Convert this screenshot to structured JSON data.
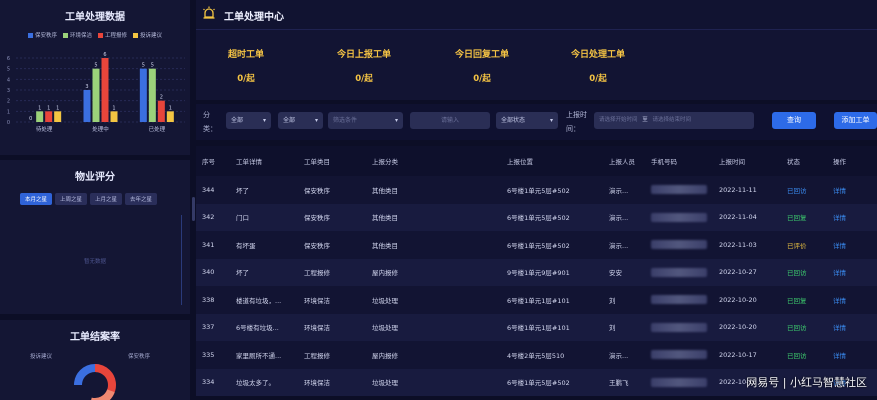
{
  "left": {
    "stats_title": "工单处理数据",
    "legend": [
      {
        "label": "保安秩序",
        "color": "#3b6fe0"
      },
      {
        "label": "环境保洁",
        "color": "#9bd27a"
      },
      {
        "label": "工程报修",
        "color": "#e8453b"
      },
      {
        "label": "投诉建议",
        "color": "#f3c542"
      }
    ],
    "y_ticks": [
      "6",
      "5",
      "4",
      "3",
      "2",
      "1",
      "0"
    ],
    "groups": [
      {
        "label": "待处理",
        "values": [
          "0",
          "1",
          "1",
          "1"
        ]
      },
      {
        "label": "处理中",
        "values": [
          "3",
          "5",
          "6",
          "1"
        ]
      },
      {
        "label": "已处理",
        "values": [
          "5",
          "5",
          "2",
          "1"
        ]
      }
    ],
    "rating_title": "物业评分",
    "rating_tabs": [
      "本月之星",
      "上周之星",
      "上月之星",
      "去年之星"
    ],
    "no_data": "暂无数据",
    "rate_title": "工单结案率",
    "donut_labels": [
      "投诉建议",
      "保安秩序"
    ]
  },
  "chart_data": {
    "type": "bar",
    "categories": [
      "待处理",
      "处理中",
      "已处理"
    ],
    "series": [
      {
        "name": "保安秩序",
        "values": [
          0,
          3,
          5
        ]
      },
      {
        "name": "环境保洁",
        "values": [
          1,
          5,
          5
        ]
      },
      {
        "name": "工程报修",
        "values": [
          1,
          6,
          2
        ]
      },
      {
        "name": "投诉建议",
        "values": [
          1,
          1,
          1
        ]
      }
    ],
    "title": "工单处理数据",
    "ylim": [
      0,
      6
    ],
    "grid": true,
    "legend_position": "top"
  },
  "header": {
    "title": "工单处理中心"
  },
  "stats": [
    {
      "label": "超时工单",
      "value": "0/起"
    },
    {
      "label": "今日上报工单",
      "value": "0/起"
    },
    {
      "label": "今日回复工单",
      "value": "0/起"
    },
    {
      "label": "今日处理工单",
      "value": "0/起"
    }
  ],
  "filters": {
    "label_category_a": "分",
    "label_category_b": "类：",
    "select1": "全部",
    "select2": "全部",
    "filter_placeholder": "筛选条件",
    "input_placeholder": "请输入",
    "status_select": "全部状态",
    "time_label_a": "上报时",
    "time_label_b": "间：",
    "start_placeholder": "请选择开始时间",
    "to": "至",
    "end_placeholder": "请选择结束时间",
    "query": "查询",
    "add": "添加工单"
  },
  "table": {
    "headers": [
      "序号",
      "工单详情",
      "工单类目",
      "上报分类",
      "上报位置",
      "上报人员",
      "手机号码",
      "上报时间",
      "状态",
      "操作"
    ],
    "rows": [
      [
        "344",
        "坏了",
        "保安秩序",
        "其他类目",
        "6号楼1单元5层#502",
        "演示...",
        "",
        "2022-11-11",
        "已回访",
        "详情"
      ],
      [
        "342",
        "门口",
        "保安秩序",
        "其他类目",
        "6号楼1单元5层#502",
        "演示...",
        "",
        "2022-11-04",
        "已回复",
        "详情"
      ],
      [
        "341",
        "有坏蛋",
        "保安秩序",
        "其他类目",
        "6号楼1单元5层#502",
        "演示...",
        "",
        "2022-11-03",
        "已评价",
        "详情"
      ],
      [
        "340",
        "坏了",
        "工程报修",
        "屋内报修",
        "9号楼1单元9层#901",
        "安安",
        "",
        "2022-10-27",
        "已回访",
        "详情"
      ],
      [
        "338",
        "楼道有垃圾，...",
        "环境保洁",
        "垃圾处理",
        "6号楼1单元1层#101",
        "刘",
        "",
        "2022-10-20",
        "已回复",
        "详情"
      ],
      [
        "337",
        "6号楼有垃圾...",
        "环境保洁",
        "垃圾处理",
        "6号楼1单元1层#101",
        "刘",
        "",
        "2022-10-20",
        "已回访",
        "详情"
      ],
      [
        "335",
        "家里厕所不通...",
        "工程报修",
        "屋内报修",
        "4号楼2单元5层510",
        "演示...",
        "",
        "2022-10-17",
        "已回访",
        "详情"
      ],
      [
        "334",
        "垃圾太多了。",
        "环境保洁",
        "垃圾处理",
        "6号楼1单元5层#502",
        "王鹏飞",
        "",
        "2022-10-13",
        "",
        "详情"
      ]
    ],
    "status_colors": [
      "st-blue",
      "st-green",
      "st-yellow",
      "st-green",
      "st-green",
      "st-green",
      "st-green",
      "st-green"
    ]
  },
  "watermark": "网易号 | 小红马智慧社区"
}
